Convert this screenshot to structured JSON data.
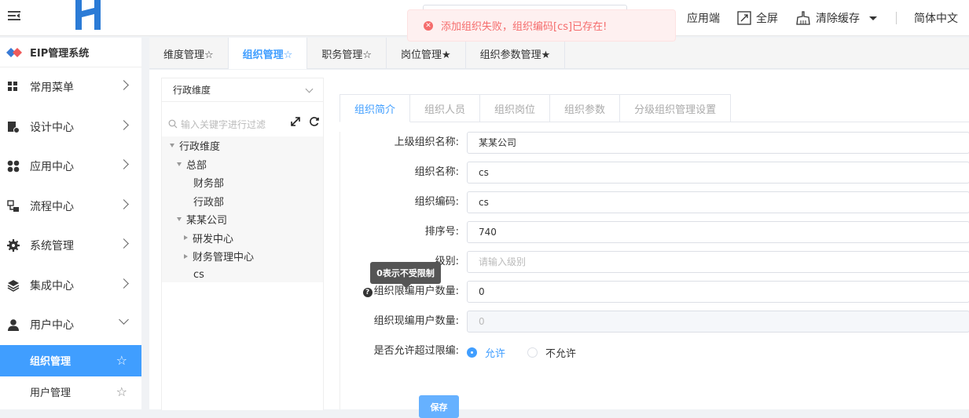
{
  "header": {
    "toast_message": "添加组织失败，组织编码[cs]已存在!",
    "app_label": "应用端",
    "fullscreen_label": "全屏",
    "clear_cache_label": "清除缓存",
    "language_label": "简体中文"
  },
  "sidebar": {
    "system_title": "EIP管理系统",
    "items": [
      {
        "label": "常用菜单",
        "icon": "grid-icon"
      },
      {
        "label": "设计中心",
        "icon": "design-icon"
      },
      {
        "label": "应用中心",
        "icon": "apps-icon"
      },
      {
        "label": "流程中心",
        "icon": "flow-icon"
      },
      {
        "label": "系统管理",
        "icon": "gear-icon"
      },
      {
        "label": "集成中心",
        "icon": "layers-icon"
      },
      {
        "label": "用户中心",
        "icon": "user-icon"
      }
    ],
    "sub_items": [
      {
        "label": "组织管理",
        "active": true
      },
      {
        "label": "用户管理",
        "active": false
      }
    ]
  },
  "tabs": [
    {
      "label": "维度管理☆",
      "active": false
    },
    {
      "label": "组织管理☆",
      "active": true
    },
    {
      "label": "职务管理☆",
      "active": false
    },
    {
      "label": "岗位管理★",
      "active": false
    },
    {
      "label": "组织参数管理★",
      "active": false
    }
  ],
  "tree_panel": {
    "select_value": "行政维度",
    "filter_placeholder": "输入关键字进行过滤",
    "nodes": [
      {
        "label": "行政维度",
        "level": 0,
        "toggle": "down"
      },
      {
        "label": "总部",
        "level": 1,
        "toggle": "down"
      },
      {
        "label": "财务部",
        "level": 2,
        "toggle": "none"
      },
      {
        "label": "行政部",
        "level": 2,
        "toggle": "none"
      },
      {
        "label": "某某公司",
        "level": 1,
        "toggle": "down"
      },
      {
        "label": "研发中心",
        "level": 2,
        "toggle": "right"
      },
      {
        "label": "财务管理中心",
        "level": 2,
        "toggle": "right"
      },
      {
        "label": "cs",
        "level": 2,
        "toggle": "none"
      }
    ]
  },
  "inner_tabs": [
    {
      "label": "组织简介",
      "active": true
    },
    {
      "label": "组织人员",
      "active": false
    },
    {
      "label": "组织岗位",
      "active": false
    },
    {
      "label": "组织参数",
      "active": false
    },
    {
      "label": "分级组织管理设置",
      "active": false
    }
  ],
  "form": {
    "parent_org_label": "上级组织名称:",
    "parent_org_value": "某某公司",
    "org_name_label": "组织名称:",
    "org_name_value": "cs",
    "org_code_label": "组织编码:",
    "org_code_value": "cs",
    "sort_label": "排序号:",
    "sort_value": "740",
    "level_label": "级别:",
    "level_placeholder": "请输入级别",
    "limit_label": "组织限编用户数量:",
    "limit_value": "0",
    "current_label": "组织现编用户数量:",
    "current_value": "0",
    "allow_exceed_label": "是否允许超过限编:",
    "allow_option": "允许",
    "deny_option": "不允许",
    "save_label": "保存",
    "tooltip": "0表示不受限制"
  },
  "colors": {
    "accent": "#409eff",
    "error": "#f56c6c"
  }
}
